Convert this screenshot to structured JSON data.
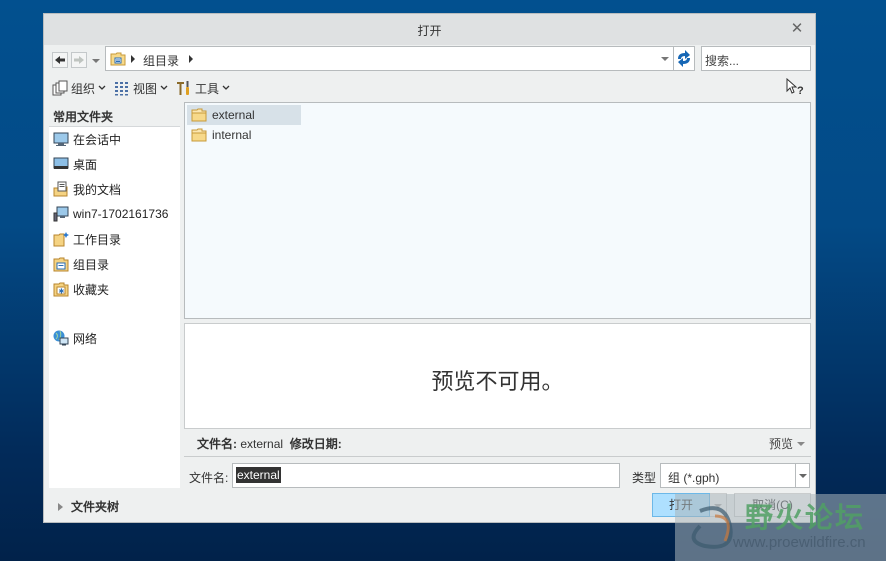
{
  "dialog": {
    "title": "打开",
    "close_icon": "close-icon"
  },
  "address": {
    "path": [
      "组目录"
    ],
    "search_placeholder": "搜索..."
  },
  "toolbar": {
    "organize": "组织",
    "view": "视图",
    "tools": "工具"
  },
  "sidebar": {
    "header": "常用文件夹",
    "items": [
      {
        "label": "在会话中",
        "icon": "monitor-icon"
      },
      {
        "label": "桌面",
        "icon": "desktop-icon"
      },
      {
        "label": "我的文档",
        "icon": "documents-icon"
      },
      {
        "label": "win7-1702161736",
        "icon": "computer-icon"
      },
      {
        "label": "工作目录",
        "icon": "working-dir-icon"
      },
      {
        "label": "组目录",
        "icon": "group-dir-icon"
      },
      {
        "label": "收藏夹",
        "icon": "favorites-icon"
      },
      {
        "label": "网络",
        "icon": "network-icon"
      }
    ]
  },
  "files": [
    {
      "name": "external",
      "selected": true
    },
    {
      "name": "internal",
      "selected": false
    }
  ],
  "preview": {
    "message": "预览不可用。",
    "toggle_label": "预览"
  },
  "info": {
    "filename_label": "文件名:",
    "filename_value": "external",
    "modified_label": "修改日期:"
  },
  "form": {
    "filename_label": "文件名:",
    "filename_value": "external",
    "type_label": "类型",
    "type_value": "组 (*.gph)"
  },
  "footer": {
    "folder_tree": "文件夹树",
    "open": "打开",
    "cancel": "取消(C)"
  },
  "watermark": {
    "title": "野火论坛",
    "url": "www.proewildfire.cn"
  }
}
